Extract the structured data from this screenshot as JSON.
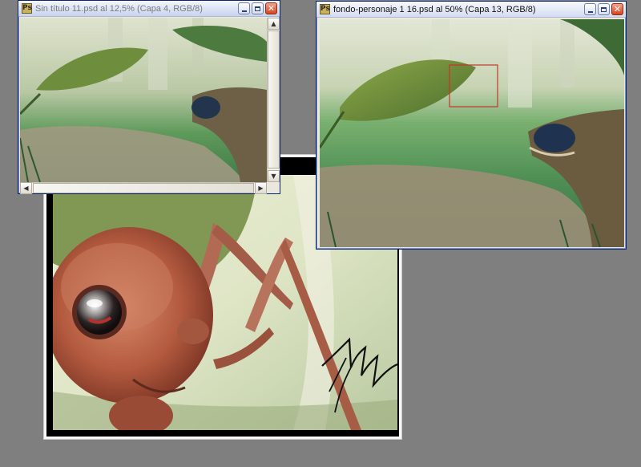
{
  "colors": {
    "desktop": "#7f7f7f",
    "window_frame": "#ece9d8",
    "title_active_text": "#111111",
    "selection_rect": "#c0392b"
  },
  "windows": [
    {
      "title": "Sin título 11.psd al 12,5% (Capa 4, RGB/8)",
      "icon": "photoshop-document-icon",
      "state": "inactive"
    },
    {
      "title": "fondo-personaje 1 16.psd al 50% (Capa 13, RGB/8)",
      "icon": "photoshop-document-icon",
      "state": "active"
    }
  ],
  "window_controls": {
    "minimize": "minimize-icon",
    "maximize": "maximize-icon",
    "close": "close-icon"
  },
  "scroll": {
    "up": "▲",
    "down": "▼",
    "left": "◀",
    "right": "▶"
  },
  "close_glyph": "✕",
  "icon_glyph": "Ps"
}
